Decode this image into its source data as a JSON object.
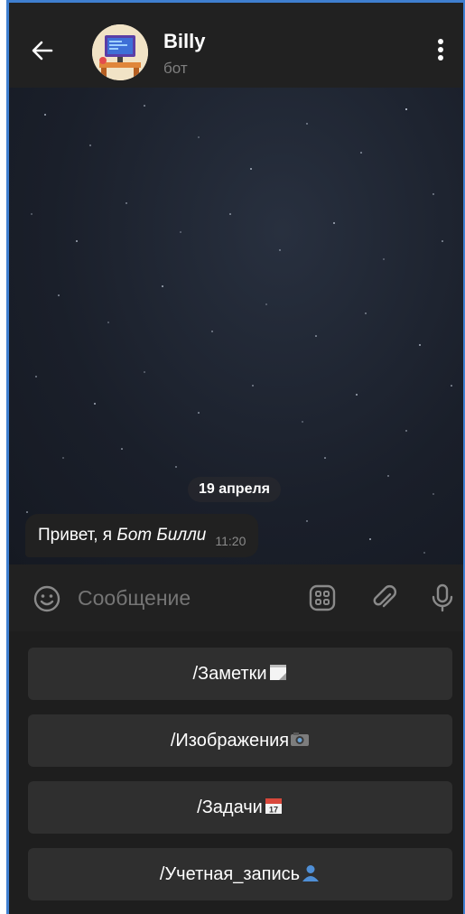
{
  "header": {
    "title": "Billy",
    "subtitle": "бот",
    "back_icon": "arrow-left-icon",
    "menu_icon": "more-vertical-icon"
  },
  "chat": {
    "date_chip": "19 апреля",
    "message": {
      "text_plain": "Привет, я ",
      "text_italic": "Бот Билли",
      "time": "11:20"
    }
  },
  "composer": {
    "placeholder": "Сообщение",
    "icons": [
      "emoji-icon",
      "bot-keyboard-icon",
      "paperclip-icon",
      "microphone-icon"
    ]
  },
  "keyboard": {
    "buttons": [
      {
        "label": "/Заметки",
        "emoji": "notepad-emoji"
      },
      {
        "label": "/Изображения",
        "emoji": "camera-emoji"
      },
      {
        "label": "/Задачи",
        "emoji": "calendar-emoji"
      },
      {
        "label": "/Учетная_запись",
        "emoji": "user-silhouette-emoji"
      }
    ]
  },
  "colors": {
    "background": "#212121",
    "chat_background": "#1a1f2a",
    "keyboard_button": "#2f2f2f",
    "frame_border": "#3f7fd0"
  }
}
